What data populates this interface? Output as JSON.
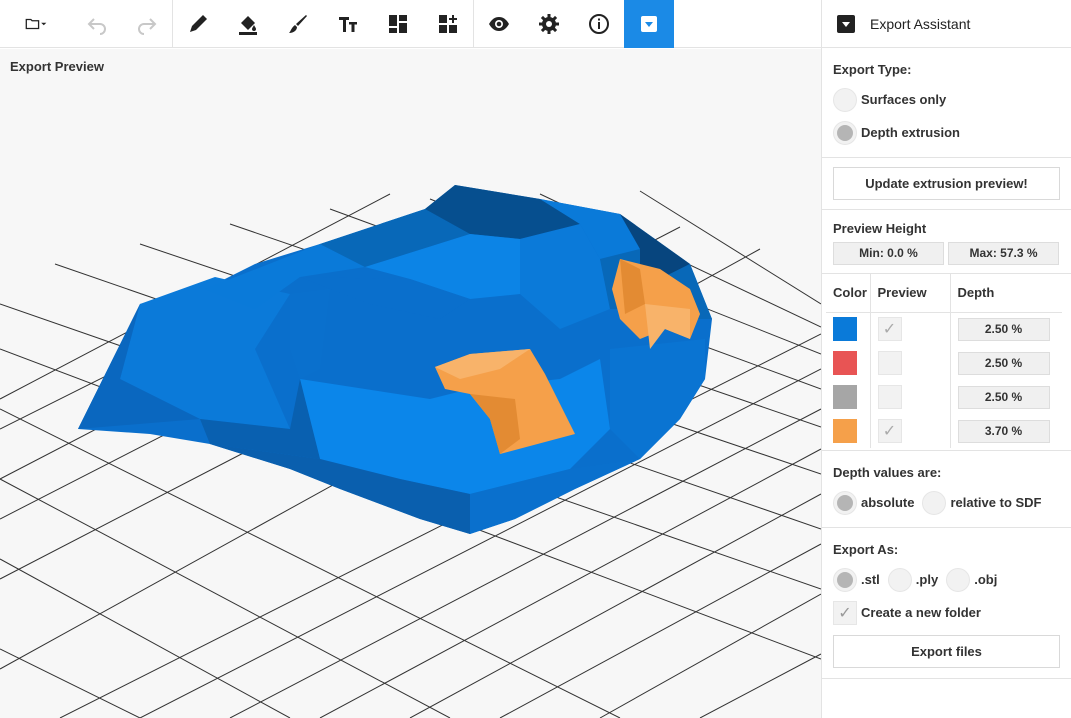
{
  "toolbar": {
    "items": [
      {
        "name": "folder-menu-icon"
      },
      {
        "name": "undo-icon"
      },
      {
        "name": "redo-icon"
      },
      {
        "name": "pencil-icon"
      },
      {
        "name": "fill-icon"
      },
      {
        "name": "brush-icon"
      },
      {
        "name": "text-icon"
      },
      {
        "name": "layout-icon"
      },
      {
        "name": "add-widget-icon"
      },
      {
        "name": "eye-icon"
      },
      {
        "name": "gear-icon"
      },
      {
        "name": "info-icon"
      },
      {
        "name": "export-icon"
      }
    ],
    "active": "export-icon"
  },
  "viewport": {
    "title": "Export Preview"
  },
  "panel": {
    "title": "Export Assistant",
    "export_type": {
      "label": "Export Type:",
      "options": [
        "Surfaces only",
        "Depth extrusion"
      ],
      "selected": "Depth extrusion"
    },
    "update_button": "Update extrusion preview!",
    "preview_height": {
      "label": "Preview Height",
      "min": "Min: 0.0 %",
      "max": "Max: 57.3 %"
    },
    "table": {
      "headers": [
        "Color",
        "Preview",
        "Depth"
      ],
      "rows": [
        {
          "color": "#0a7ad9",
          "preview": true,
          "depth": "2.50 %"
        },
        {
          "color": "#e85454",
          "preview": false,
          "depth": "2.50 %"
        },
        {
          "color": "#a6a6a6",
          "preview": false,
          "depth": "2.50 %"
        },
        {
          "color": "#f5a04a",
          "preview": true,
          "depth": "3.70 %"
        }
      ]
    },
    "depth_values": {
      "label": "Depth values are:",
      "options": [
        "absolute",
        "relative to SDF"
      ],
      "selected": "absolute"
    },
    "export_as": {
      "label": "Export As:",
      "options": [
        ".stl",
        ".ply",
        ".obj"
      ],
      "selected": ".stl",
      "new_folder_label": "Create a new folder",
      "new_folder_checked": true
    },
    "export_button": "Export files"
  },
  "colors": {
    "accent": "#1b8ae6",
    "mesh_blue": "#0a7ad9",
    "mesh_orange": "#f5a04a"
  }
}
